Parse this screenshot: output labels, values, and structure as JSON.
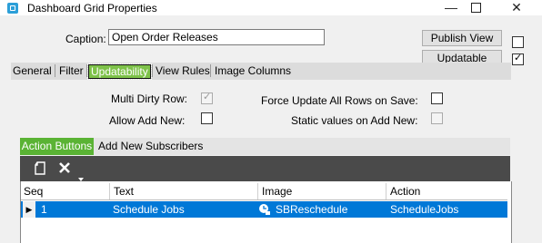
{
  "window": {
    "title": "Dashboard Grid Properties"
  },
  "caption": {
    "label": "Caption:",
    "value": "Open Order Releases"
  },
  "buttons": {
    "publish_view": "Publish View",
    "updatable": "Updatable"
  },
  "side_checks": {
    "publish_checked": false,
    "updatable_checked": true
  },
  "tabs": [
    {
      "label": "General"
    },
    {
      "label": "Filter"
    },
    {
      "label": "Updatability"
    },
    {
      "label": "View Rules"
    },
    {
      "label": "Image Columns"
    }
  ],
  "options": {
    "multi_dirty_row": {
      "label": "Multi Dirty Row:",
      "checked": true
    },
    "allow_add_new": {
      "label": "Allow Add New:",
      "checked": false
    },
    "force_update": {
      "label": "Force Update All Rows on Save:",
      "checked": false
    },
    "static_values": {
      "label": "Static values on Add New:",
      "checked": false
    }
  },
  "inner_tabs": [
    {
      "label": "Action Buttons"
    },
    {
      "label": "Add New Subscribers"
    }
  ],
  "toolbar": {
    "icons": [
      "new-icon",
      "delete-icon",
      "dropdown-arrow-icon"
    ]
  },
  "grid": {
    "columns": [
      "Seq",
      "Text",
      "Image",
      "Action"
    ],
    "rows": [
      {
        "seq": "1",
        "text": "Schedule Jobs",
        "image": "SBReschedule",
        "action": "ScheduleJobs"
      }
    ]
  },
  "colors": {
    "accent": "#5ab334",
    "selected_row": "#0078d7",
    "toolbar": "#4a4a4a"
  }
}
